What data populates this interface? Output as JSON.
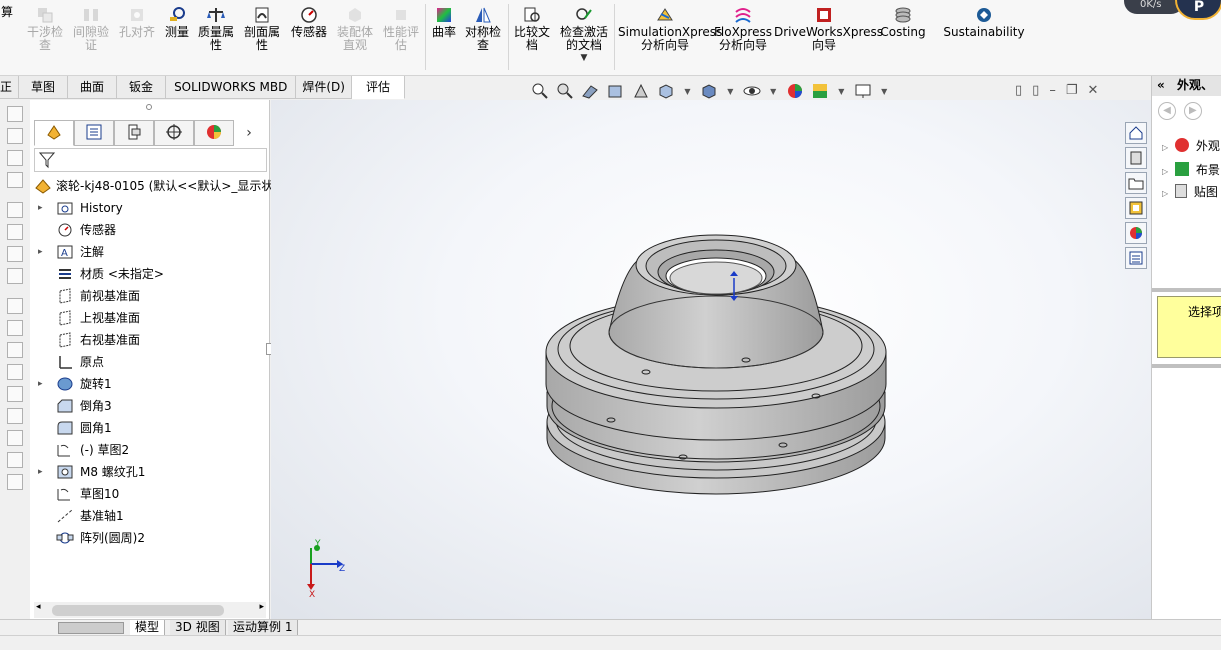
{
  "ribbon": {
    "left_cut": "算",
    "buttons": [
      {
        "label": "干涉检\n查",
        "icon": "interference-check-icon",
        "disabled": true
      },
      {
        "label": "间隙验\n证",
        "icon": "clearance-verify-icon",
        "disabled": true
      },
      {
        "label": "孔对齐",
        "icon": "hole-alignment-icon",
        "disabled": true
      },
      {
        "label": "测量",
        "icon": "measure-icon",
        "disabled": false
      },
      {
        "label": "质量属\n性",
        "icon": "mass-properties-icon",
        "disabled": false
      },
      {
        "label": "剖面属\n性",
        "icon": "section-properties-icon",
        "disabled": false
      },
      {
        "label": "传感器",
        "icon": "sensor-icon",
        "disabled": false
      },
      {
        "label": "装配体\n直观",
        "icon": "assembly-visualization-icon",
        "disabled": true
      },
      {
        "label": "性能评\n估",
        "icon": "performance-evaluation-icon",
        "disabled": true
      },
      {
        "label": "曲率",
        "icon": "curvature-icon",
        "disabled": false
      },
      {
        "label": "对称检\n查",
        "icon": "symmetry-check-icon",
        "disabled": false
      },
      {
        "label": "比较文\n档",
        "icon": "compare-documents-icon",
        "disabled": false
      },
      {
        "label": "检查激活\n的文档",
        "icon": "check-active-document-icon",
        "disabled": false
      },
      {
        "label": "SimulationXpress\n分析向导",
        "icon": "simulationxpress-icon",
        "disabled": false
      },
      {
        "label": "FloXpress\n分析向导",
        "icon": "floxpress-icon",
        "disabled": false
      },
      {
        "label": "DriveWorksXpress\n向导",
        "icon": "driveworksxpress-icon",
        "disabled": false
      },
      {
        "label": "Costing",
        "icon": "costing-icon",
        "disabled": false
      },
      {
        "label": "Sustainability",
        "icon": "sustainability-icon",
        "disabled": false
      }
    ],
    "speed": "0K/s"
  },
  "tabs": [
    {
      "label": "正",
      "active": false
    },
    {
      "label": "草图",
      "active": false
    },
    {
      "label": "曲面",
      "active": false
    },
    {
      "label": "钣金",
      "active": false
    },
    {
      "label": "SOLIDWORKS MBD",
      "active": false
    },
    {
      "label": "焊件(D)",
      "active": false
    },
    {
      "label": "评估",
      "active": true
    }
  ],
  "feature_tree": {
    "root": "滚轮-kj48-0105 (默认<<默认>_显示状",
    "items": [
      {
        "label": "History",
        "icon": "history-folder-icon",
        "expandable": true
      },
      {
        "label": "传感器",
        "icon": "sensor-icon",
        "expandable": false
      },
      {
        "label": "注解",
        "icon": "annotations-icon",
        "expandable": true
      },
      {
        "label": "材质 <未指定>",
        "icon": "material-icon",
        "expandable": false
      },
      {
        "label": "前视基准面",
        "icon": "plane-icon",
        "expandable": false
      },
      {
        "label": "上视基准面",
        "icon": "plane-icon",
        "expandable": false
      },
      {
        "label": "右视基准面",
        "icon": "plane-icon",
        "expandable": false
      },
      {
        "label": "原点",
        "icon": "origin-icon",
        "expandable": false
      },
      {
        "label": "旋转1",
        "icon": "revolve-icon",
        "expandable": true
      },
      {
        "label": "倒角3",
        "icon": "chamfer-icon",
        "expandable": false
      },
      {
        "label": "圆角1",
        "icon": "fillet-icon",
        "expandable": false
      },
      {
        "label": "(-) 草图2",
        "icon": "sketch-icon",
        "expandable": false
      },
      {
        "label": "M8 螺纹孔1",
        "icon": "hole-wizard-icon",
        "expandable": true
      },
      {
        "label": "草图10",
        "icon": "sketch-icon",
        "expandable": false
      },
      {
        "label": "基准轴1",
        "icon": "axis-icon",
        "expandable": false
      },
      {
        "label": "阵列(圆周)2",
        "icon": "circular-pattern-icon",
        "expandable": false
      }
    ]
  },
  "right_panel": {
    "title": "外观、",
    "items": [
      "外观",
      "布景",
      "贴图"
    ],
    "hint": "选择项"
  },
  "bottom_tabs": [
    {
      "label": "模型",
      "active": true
    },
    {
      "label": "3D 视图",
      "active": false
    },
    {
      "label": "运动算例 1",
      "active": false
    }
  ],
  "triad": {
    "y": "Y",
    "z": "Z",
    "x": "X"
  }
}
